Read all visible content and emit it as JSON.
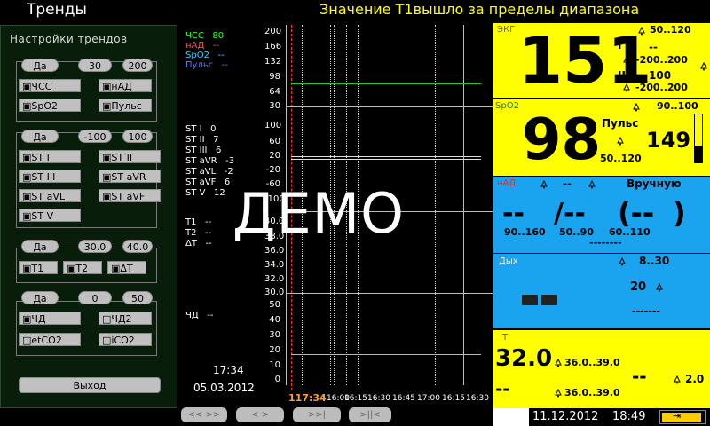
{
  "header": {
    "title": "Тренды",
    "alarm": "Значение T1вышло за пределы диапазона"
  },
  "settings": {
    "title": "Настройки трендов",
    "group1": {
      "btn1": "Да",
      "btn2": "30",
      "btn3": "200",
      "params": [
        "ЧСС",
        "нАД",
        "SpO2",
        "Пульс"
      ]
    },
    "group2": {
      "btn1": "Да",
      "btn2": "-100",
      "btn3": "100",
      "params": [
        "ST I",
        "ST II",
        "ST III",
        "ST aVR",
        "ST aVL",
        "ST aVF",
        "ST V"
      ]
    },
    "group3": {
      "btn1": "Да",
      "btn2": "30.0",
      "btn3": "40.0",
      "params": [
        "T1",
        "T2",
        "ΔT"
      ]
    },
    "group4": {
      "btn1": "Да",
      "btn2": "0",
      "btn3": "50",
      "params": [
        "ЧД",
        "ЧД2",
        "etCO2",
        "iCO2"
      ]
    },
    "exit": "Выход"
  },
  "graph": {
    "legend1": [
      {
        "name": "ЧСС",
        "value": "80",
        "color": "#33ff33"
      },
      {
        "name": "нАД",
        "value": "--",
        "color": "#ff5050"
      },
      {
        "name": "SpO2",
        "value": "--",
        "color": "#44ccff"
      },
      {
        "name": "Пульс",
        "value": "--",
        "color": "#5577ff"
      }
    ],
    "legend2": [
      {
        "name": "ST I",
        "value": "0"
      },
      {
        "name": "ST II",
        "value": "7"
      },
      {
        "name": "ST III",
        "value": "6"
      },
      {
        "name": "ST aVR",
        "value": "-3"
      },
      {
        "name": "ST aVL",
        "value": "-2"
      },
      {
        "name": "ST aVF",
        "value": "6"
      },
      {
        "name": "ST V",
        "value": "12"
      }
    ],
    "legend3": [
      {
        "name": "T1",
        "value": "--"
      },
      {
        "name": "T2",
        "value": "--"
      },
      {
        "name": "ΔT",
        "value": "--"
      }
    ],
    "legend4": [
      {
        "name": "ЧД",
        "value": "--"
      }
    ],
    "yaxis1": [
      "200",
      "166",
      "132",
      "98",
      "64",
      "30"
    ],
    "yaxis2": [
      "100",
      "60",
      "20",
      "-20",
      "-60",
      "-100"
    ],
    "yaxis3": [
      "40.0",
      "38.0",
      "36.0",
      "34.0",
      "32.0",
      "30.0"
    ],
    "yaxis4": [
      "50",
      "40",
      "30",
      "20",
      "10",
      "0"
    ],
    "time": "17:34",
    "date": "05.03.2012",
    "cursor_time": "117:34",
    "xticks": [
      "16:00",
      "16:15",
      "16:30",
      "16:45",
      "17:00",
      "16:15",
      "16:30"
    ],
    "watermark": "ДЕМО"
  },
  "nav": {
    "btn1": "<< >>",
    "btn2": "< >",
    "btn3": ">>|",
    "btn4": ">||<"
  },
  "ecg": {
    "label": "ЭКГ",
    "hr": "151",
    "lead1": "I",
    "lead2": "II",
    "limit_hr": "50..120",
    "st1": "--",
    "st1_range": "-200..200",
    "st2": "100",
    "st2_range": "-200..200"
  },
  "spo2": {
    "label": "SpO2",
    "value": "98",
    "limit": "90..100",
    "pulse_label": "Пульс",
    "pulse": "149",
    "pulse_limit": "50..120",
    "bar_level": 0.35
  },
  "nibp": {
    "label": "нАД",
    "limit_top": "--",
    "mode": "Вручную",
    "sys": "--",
    "dia": "/--",
    "mean": "(--",
    "close": ")",
    "r1": "90..160",
    "r2": "50..90",
    "r3": "60..110",
    "dashes": "--------"
  },
  "resp": {
    "label": "Дых",
    "limit": "8..30",
    "value": "20",
    "dashes": "-------"
  },
  "temp": {
    "label": "T",
    "t1": "32.0",
    "t1_range": "36.0..39.0",
    "t2": "--",
    "t2_range": "36.0..39.0",
    "dt": "--",
    "dt_limit": "2.0"
  },
  "status": {
    "date": "11.12.2012",
    "time": "18:49"
  }
}
